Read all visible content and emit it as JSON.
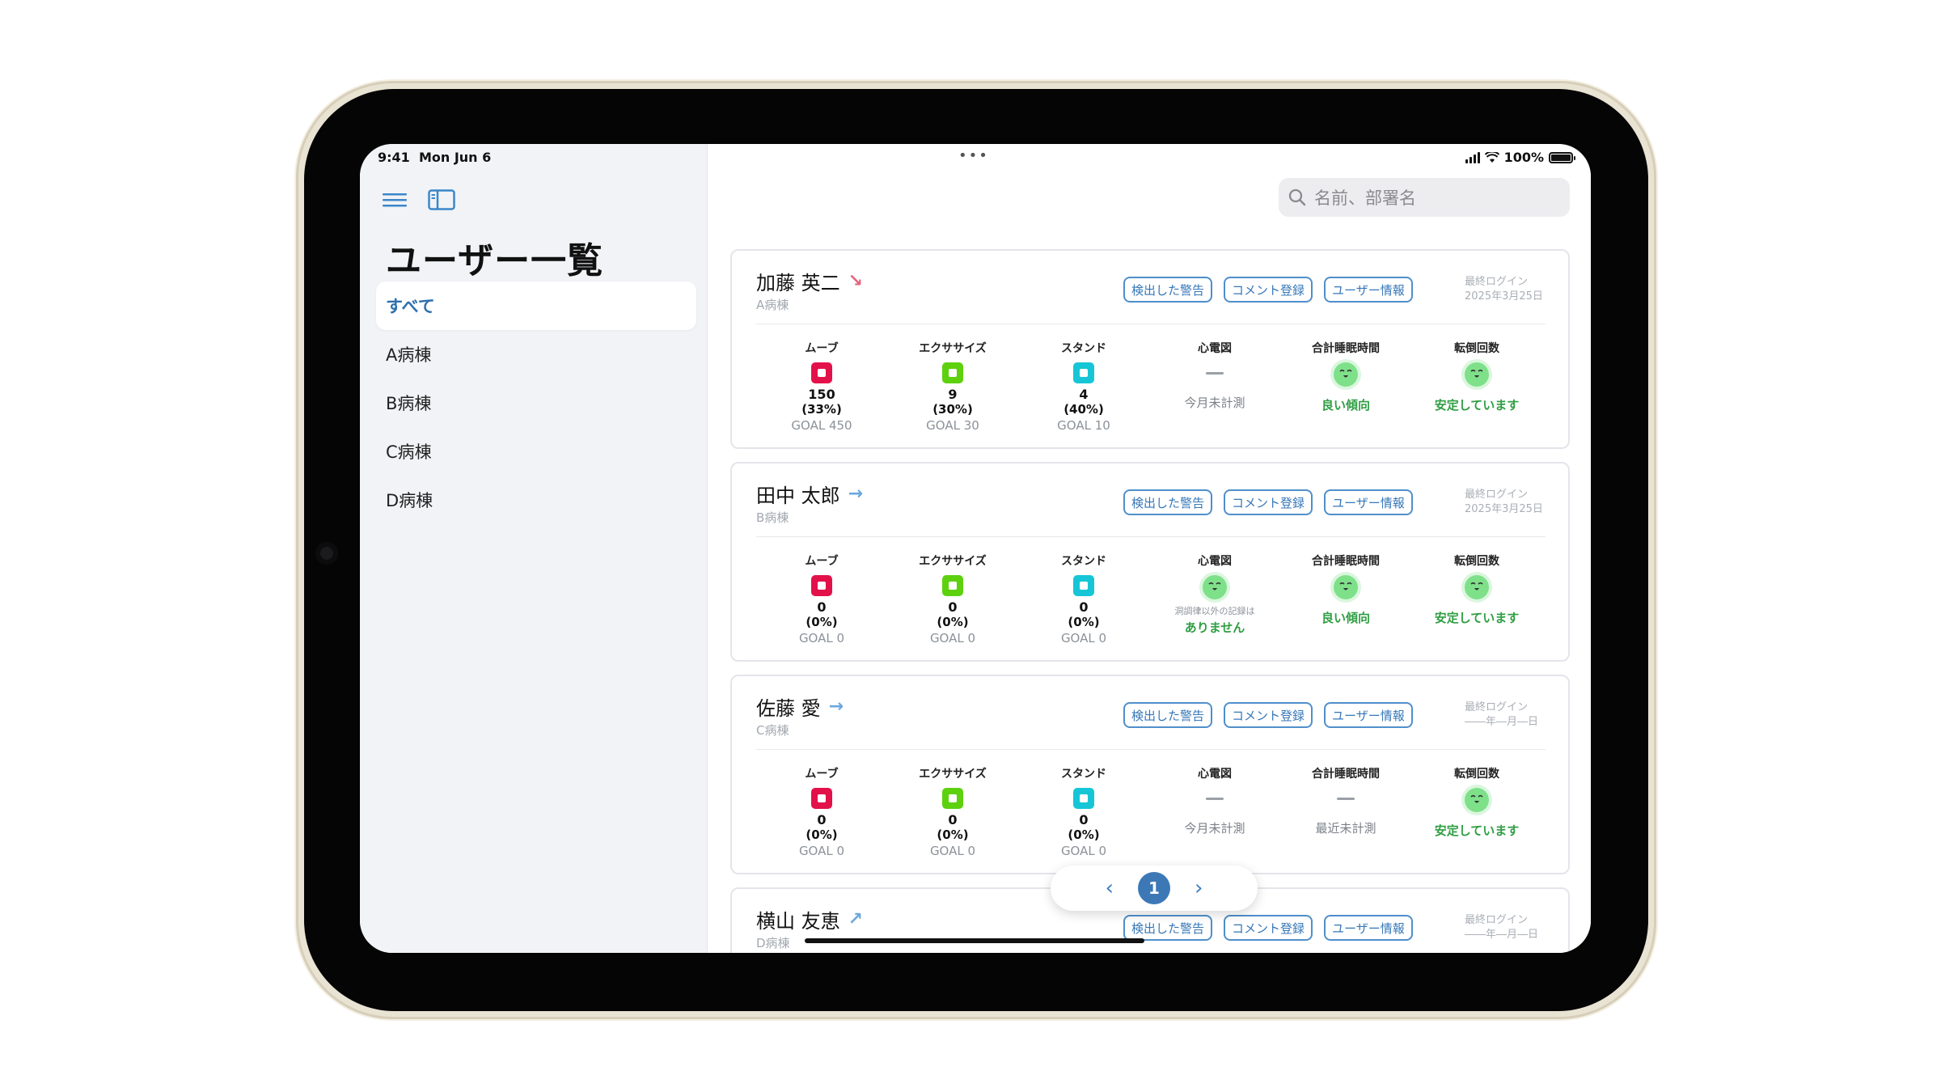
{
  "status": {
    "time": "9:41",
    "date": "Mon Jun 6",
    "battery": "100%"
  },
  "sidebar": {
    "title": "ユーザー一覧",
    "items": [
      {
        "label": "すべて",
        "active": true
      },
      {
        "label": "A病棟"
      },
      {
        "label": "B病棟"
      },
      {
        "label": "C病棟"
      },
      {
        "label": "D病棟"
      }
    ]
  },
  "search": {
    "placeholder": "名前、部署名"
  },
  "buttons": {
    "alerts": "検出した警告",
    "comment": "コメント登録",
    "userinfo": "ユーザー情報"
  },
  "login_label": "最終ログイン",
  "metric_labels": {
    "move": "ムーブ",
    "exercise": "エクササイズ",
    "stand": "スタンド",
    "ecg": "心電図",
    "sleep": "合計睡眠時間",
    "falls": "転倒回数"
  },
  "colors": {
    "move": "#e3114a",
    "exercise": "#5ed10f",
    "stand": "#16c6d6",
    "accent": "#3d78b6",
    "ok": "#2f9e43"
  },
  "users": [
    {
      "name": "加藤 英二",
      "trend": "↘",
      "trend_color": "#e5657e",
      "ward": "A病棟",
      "last_login": "2025年3月25日",
      "move": {
        "value": "150",
        "pct": "(33%)",
        "goal": "GOAL 450"
      },
      "exercise": {
        "value": "9",
        "pct": "(30%)",
        "goal": "GOAL 30"
      },
      "stand": {
        "value": "4",
        "pct": "(40%)",
        "goal": "GOAL 10"
      },
      "ecg": "今月未計測",
      "sleep": "良い傾向",
      "falls": "安定しています"
    },
    {
      "name": "田中 太郎",
      "trend": "→",
      "trend_color": "#6aa8dc",
      "ward": "B病棟",
      "last_login": "2025年3月25日",
      "move": {
        "value": "0",
        "pct": "(0%)",
        "goal": "GOAL 0"
      },
      "exercise": {
        "value": "0",
        "pct": "(0%)",
        "goal": "GOAL 0"
      },
      "stand": {
        "value": "0",
        "pct": "(0%)",
        "goal": "GOAL 0"
      },
      "ecg_note": "洞調律以外の記録は",
      "ecg": "ありません",
      "sleep": "良い傾向",
      "falls": "安定しています"
    },
    {
      "name": "佐藤 愛",
      "trend": "→",
      "trend_color": "#6aa8dc",
      "ward": "C病棟",
      "last_login": "――年―月―日",
      "move": {
        "value": "0",
        "pct": "(0%)",
        "goal": "GOAL 0"
      },
      "exercise": {
        "value": "0",
        "pct": "(0%)",
        "goal": "GOAL 0"
      },
      "stand": {
        "value": "0",
        "pct": "(0%)",
        "goal": "GOAL 0"
      },
      "ecg": "今月未計測",
      "sleep": "最近未計測",
      "falls": "安定しています"
    },
    {
      "name": "横山 友恵",
      "trend": "↗",
      "trend_color": "#6aa8dc",
      "ward": "D病棟",
      "last_login": "――年―月―日"
    }
  ],
  "pager": {
    "current": "1"
  }
}
